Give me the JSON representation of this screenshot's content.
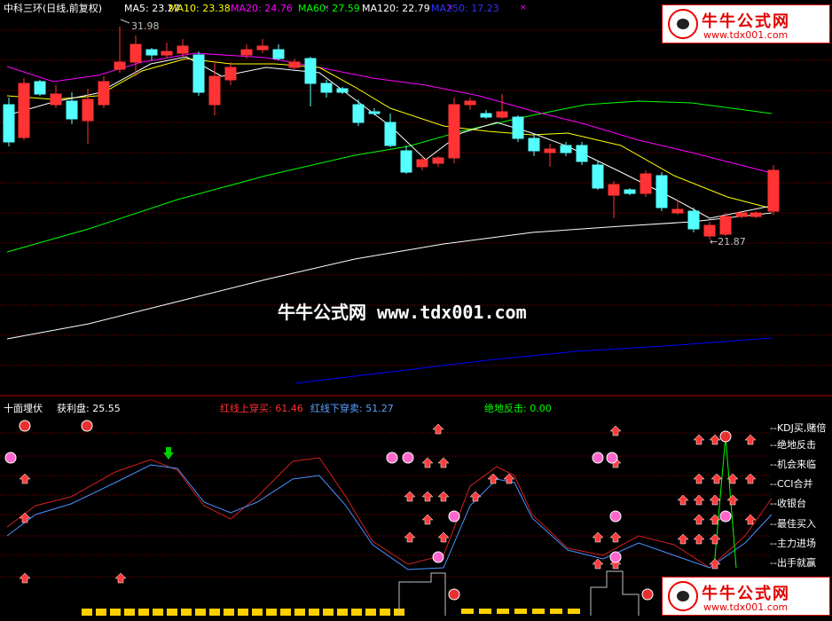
{
  "header": {
    "title": "中科三环(日线,前复权)",
    "ma": [
      {
        "label": "MA5: 23.27",
        "color": "#ffffff"
      },
      {
        "label": "MA10: 23.38",
        "color": "#ffff00"
      },
      {
        "label": "MA20: 24.76",
        "color": "#ff00ff"
      },
      {
        "label": "MA60: 27.59",
        "color": "#00ff00"
      },
      {
        "label": "MA120: 22.79",
        "color": "#ffffff"
      },
      {
        "label": "MA250: 17.23",
        "color": "#0000ff"
      }
    ]
  },
  "price_marks": {
    "high": "31.98",
    "low": "←21.87"
  },
  "watermark": "牛牛公式网 www.tdx001.com",
  "logo": {
    "title": "牛牛公式网",
    "url": "www.tdx001.com"
  },
  "indicator": {
    "name": "十面埋伏",
    "profit": "获利盘: 25.55",
    "red_cross": "红线上穿买: 61.46",
    "blue_cross": "红线下穿卖: 51.27",
    "rebound": "绝地反击: 0.00",
    "legend": [
      "--KDJ买,赌倍",
      "--绝地反击",
      "--机会来临",
      "--CCI合并",
      "--收银台",
      "--最佳买入",
      "--主力进场",
      "--出手就赢"
    ]
  },
  "colors": {
    "up": "#ff3333",
    "down": "#54ffff",
    "grid": "#8b0000",
    "ma5": "#ffffff",
    "ma10": "#ffff00",
    "ma20": "#ff00ff",
    "ma60": "#00ff00",
    "ma120": "#ffffff",
    "ma250": "#0000ff"
  }
}
